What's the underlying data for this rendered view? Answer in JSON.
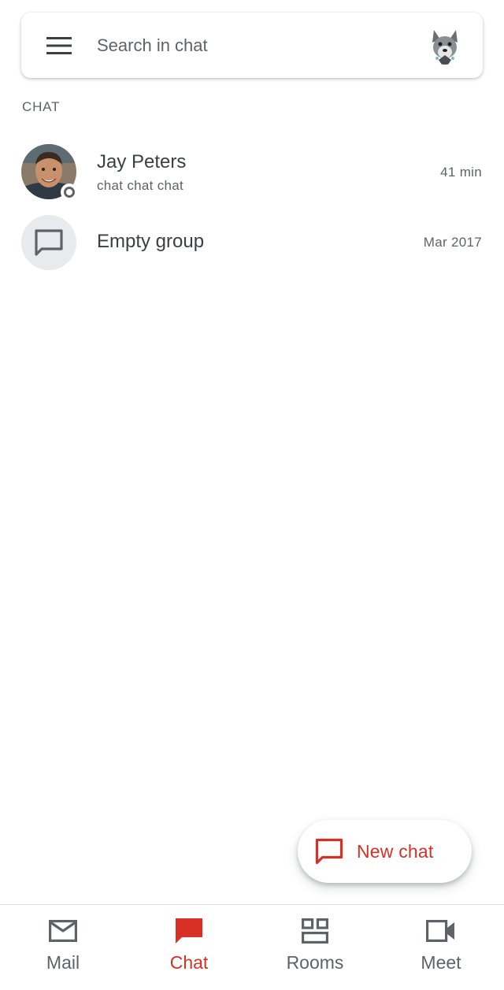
{
  "search": {
    "placeholder": "Search in chat"
  },
  "section": {
    "label": "CHAT"
  },
  "conversations": [
    {
      "name": "Jay Peters",
      "snippet": "chat chat chat",
      "time": "41 min",
      "avatar": "person-photo",
      "presence": "away"
    },
    {
      "name": "Empty group",
      "snippet": "",
      "time": "Mar 2017",
      "avatar": "group-chat-icon"
    }
  ],
  "fab": {
    "label": "New chat",
    "icon": "chat-bubble-outline-icon"
  },
  "nav": {
    "items": [
      {
        "label": "Mail",
        "icon": "mail-icon",
        "active": false
      },
      {
        "label": "Chat",
        "icon": "chat-icon",
        "active": true
      },
      {
        "label": "Rooms",
        "icon": "rooms-icon",
        "active": false
      },
      {
        "label": "Meet",
        "icon": "video-camera-icon",
        "active": false
      }
    ]
  },
  "colors": {
    "accent": "#d93025",
    "text_primary": "#3c4043",
    "text_secondary": "#5f6368",
    "avatar_bg": "#e8eaed"
  }
}
